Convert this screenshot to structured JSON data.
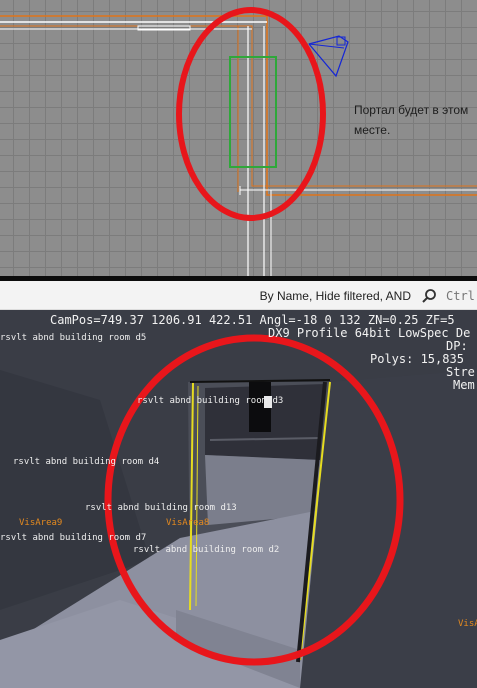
{
  "top_viewport": {
    "note_text": "Портал будет в этом месте."
  },
  "toolbar": {
    "filter_label": "By Name, Hide filtered, AND",
    "search_placeholder": "Ctrl"
  },
  "scene": {
    "hud": {
      "cam_pos": "CamPos=749.37 1206.91 422.51 Angl=-18  0 132 ZN=0.25 ZF=5",
      "profile": "DX9 Profile 64bit LowSpec De",
      "dp": "DP:",
      "polys": "Polys: 15,835",
      "stre": "Stre",
      "mem": "Mem"
    },
    "labels": [
      {
        "text": "rsvlt abnd building room d5",
        "color": "white"
      },
      {
        "text": "rsvlt abnd building room d3",
        "color": "white"
      },
      {
        "text": "rsvlt abnd building room d4",
        "color": "white"
      },
      {
        "text": "rsvlt abnd building room d13",
        "color": "white"
      },
      {
        "text": "VisArea9",
        "color": "orange"
      },
      {
        "text": "VisArea8",
        "color": "orange"
      },
      {
        "text": "rsvlt abnd building room d7",
        "color": "white"
      },
      {
        "text": "rsvlt abnd building room d2",
        "color": "white"
      },
      {
        "text": "VisA",
        "color": "orange"
      }
    ]
  },
  "colors": {
    "highlight_circle": "#e8161b",
    "portal_box": "#2fa83a",
    "wall_outline": "#e0741a",
    "camera_gizmo": "#1426d6",
    "hud_text": "#f2f2f2",
    "visarea_label": "#e58a1f",
    "portal_lines": "#e6dc20"
  }
}
